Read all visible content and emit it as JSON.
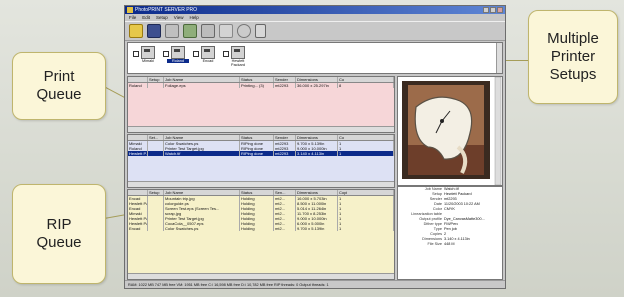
{
  "window": {
    "title": "PhotoPRINT SERVER PRO"
  },
  "menu": [
    "File",
    "Edit",
    "Setup",
    "View",
    "Help"
  ],
  "toolbar_icons": [
    "open-folder-icon",
    "save-icon",
    "printer-icon",
    "setup-icon",
    "print-icon",
    "link-icon",
    "globe-icon",
    "trash-icon"
  ],
  "printers": [
    {
      "name": "Mimaki",
      "selected": false
    },
    {
      "name": "Roland",
      "selected": true
    },
    {
      "name": "Encad",
      "selected": false
    },
    {
      "name": "Hewlett Packard",
      "selected": false
    }
  ],
  "callouts": {
    "print_queue": "Print\nQueue",
    "rip_queue": "RIP\nQueue",
    "multiple_setups": "Multiple\nPrinter\nSetups"
  },
  "print_queue": {
    "color": "#f6d6d8",
    "columns": [
      "",
      "Setup",
      "Job Name",
      "Status",
      "Sender",
      "Dimensions",
      "Co"
    ],
    "rows": [
      [
        "Roland",
        "",
        "Foliage.eps",
        "Printing... (3)",
        "mt2293",
        "36.000 x 25.297in",
        "8"
      ]
    ]
  },
  "mid_queue": {
    "color": "#dde1f4",
    "columns": [
      "",
      "Set...",
      "Job Name",
      "Status",
      "Sender",
      "Dimensions",
      "Co"
    ],
    "rows": [
      [
        "Mimaki",
        "",
        "Color Swatches.ps",
        "RIPing done",
        "mt2293",
        "9.700 x 5.139in",
        "1"
      ],
      [
        "Roland",
        "",
        "Printer Test Target.jpg",
        "RIPing done",
        "mt2293",
        "9.000 x 10.000in",
        "1"
      ],
      [
        "Hewlett P...",
        "",
        "Watch.tif",
        "RIPing done",
        "mt2293",
        "3.140 x 4.113in",
        "1"
      ]
    ],
    "selected_index": 2
  },
  "rip_queue": {
    "color": "#f6f1c9",
    "columns": [
      "",
      "Setup",
      "Job Name",
      "Status",
      "Sen...",
      "Dimensions",
      "Copi"
    ],
    "rows": [
      [
        "Encad",
        "",
        "Mountain trip.jpg",
        "Holding",
        "mt2...",
        "16.000 x 5.703in",
        "1"
      ],
      [
        "Hewlett Pa...",
        "",
        "colorguide.ps",
        "Holding",
        "mt2...",
        "8.500 x 11.000in",
        "1"
      ],
      [
        "Encad",
        "",
        "Screen Test.eps (Screen Tes...",
        "Holding",
        "mt2...",
        "5.014 x 11.264in",
        "1"
      ],
      [
        "Mimaki",
        "",
        "scrap.jpg",
        "Holding",
        "mt2...",
        "11.700 x 8.253in",
        "1"
      ],
      [
        "Hewlett Pa...",
        "",
        "Printer Test Target.jpg",
        "Holding",
        "mt2...",
        "9.000 x 10.000in",
        "1"
      ],
      [
        "Hewlett Pa...",
        "",
        "CocaCola__0507.eps",
        "Holding",
        "mt2...",
        "6.000 x 5.000in",
        "1"
      ],
      [
        "Encad",
        "",
        "Color Swatches.ps",
        "Holding",
        "mt2...",
        "9.700 x 5.139in",
        "1"
      ]
    ]
  },
  "job_info": [
    [
      "Job Name",
      "Watch.tif"
    ],
    [
      "Setup",
      "Hewlett Packard"
    ],
    [
      "Sender",
      "mt2293"
    ],
    [
      "Date",
      "11/20/2003 10:22 AM"
    ],
    [
      "Color",
      "CMYK"
    ],
    [
      "Linearization table",
      ""
    ],
    [
      "Output profile",
      "Dye_CanvasMatte300..."
    ],
    [
      "Dither type",
      "FM/Perc"
    ],
    [
      "Type",
      "Pen job"
    ],
    [
      "Copies",
      "2"
    ],
    [
      "Dimensions",
      "3.140 x 4.113in"
    ],
    [
      "File Size",
      "448 M"
    ]
  ],
  "status_bar": "RAM: 1022 MB 747 MB free VM: 1951 MB free C:\\ 16,598 MB free D:\\ 10,782 MB free RIP threads: 0 Output threads: 1"
}
